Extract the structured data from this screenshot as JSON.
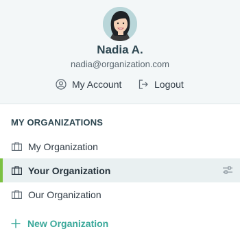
{
  "user": {
    "name": "Nadia A.",
    "email": "nadia@organization.com"
  },
  "account_actions": {
    "my_account_label": "My Account",
    "logout_label": "Logout"
  },
  "organizations": {
    "section_title": "MY ORGANIZATIONS",
    "items": [
      {
        "label": "My Organization",
        "active": false
      },
      {
        "label": "Your Organization",
        "active": true
      },
      {
        "label": "Our Organization",
        "active": false
      }
    ],
    "new_label": "New Organization"
  },
  "colors": {
    "active_indicator": "#7cc142",
    "accent": "#3aa89a",
    "profile_background": "#f3f7f8",
    "active_background": "#e9f0f1"
  },
  "icons": {
    "avatar": "avatar-portrait",
    "my_account": "user-circle-icon",
    "logout": "logout-arrow-icon",
    "organization": "briefcase-icon",
    "settings": "sliders-icon",
    "new": "plus-icon"
  }
}
